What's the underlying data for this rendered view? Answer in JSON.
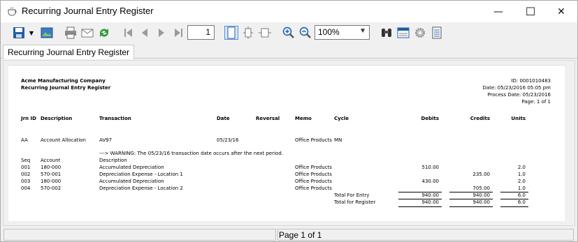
{
  "window": {
    "title": "Recurring Journal Entry Register",
    "minimize_glyph": "—",
    "maximize_glyph": "☐",
    "close_glyph": "✕"
  },
  "toolbar": {
    "page_number": "1",
    "zoom": "100%"
  },
  "tabs": [
    {
      "label": "Recurring Journal Entry Register"
    }
  ],
  "report": {
    "company": "Acme Manufacturing Company",
    "title": "Recurring Journal Entry Register",
    "id_line": "ID: 0001010483",
    "date_line": "Date: 05/23/2016 05:05 pm",
    "process_date_line": "Process Date: 05/23/2016",
    "page_line": "Page: 1 of 1",
    "headers": {
      "jrn_id": "Jrn ID",
      "description": "Description",
      "transaction": "Transaction",
      "date": "Date",
      "reversal": "Reversal",
      "memo": "Memo",
      "cycle": "Cycle",
      "debits": "Debits",
      "credits": "Credits",
      "units": "Units"
    },
    "entry": {
      "jrn_id": "AA",
      "description": "Account Allocation",
      "transaction": "AV97",
      "date": "05/23/16",
      "memo": "Office Products",
      "cycle": "MN"
    },
    "warning": "---> WARNING: The 05/23/16 transaction date occurs after the next period.",
    "detail_headers": {
      "seq": "Seq",
      "account": "Account",
      "description": "Description"
    },
    "lines": [
      {
        "seq": "001",
        "account": "180-000",
        "description": "Accumulated Depreciation",
        "memo": "Office Products",
        "debit": "510.00",
        "credit": "",
        "units": "2.0"
      },
      {
        "seq": "002",
        "account": "570-001",
        "description": "Depreciation Expense - Location 1",
        "memo": "Office Products",
        "debit": "",
        "credit": "235.00",
        "units": "1.0"
      },
      {
        "seq": "003",
        "account": "180-000",
        "description": "Accumulated Depreciation",
        "memo": "Office Products",
        "debit": "430.00",
        "credit": "",
        "units": "2.0"
      },
      {
        "seq": "004",
        "account": "570-002",
        "description": "Depreciation Expense - Location 2",
        "memo": "Office Products",
        "debit": "",
        "credit": "705.00",
        "units": "1.0"
      }
    ],
    "total_entry": {
      "label": "Total For Entry",
      "debit": "940.00",
      "credit": "940.00",
      "units": "6.0"
    },
    "total_register": {
      "label": "Total for Register",
      "debit": "940.00",
      "credit": "940.00",
      "units": "6.0"
    }
  },
  "status": {
    "page_text": "Page 1 of 1"
  },
  "colors": {
    "toolbar_blue": "#1f5fa8",
    "refresh_green": "#2e9b3a"
  }
}
